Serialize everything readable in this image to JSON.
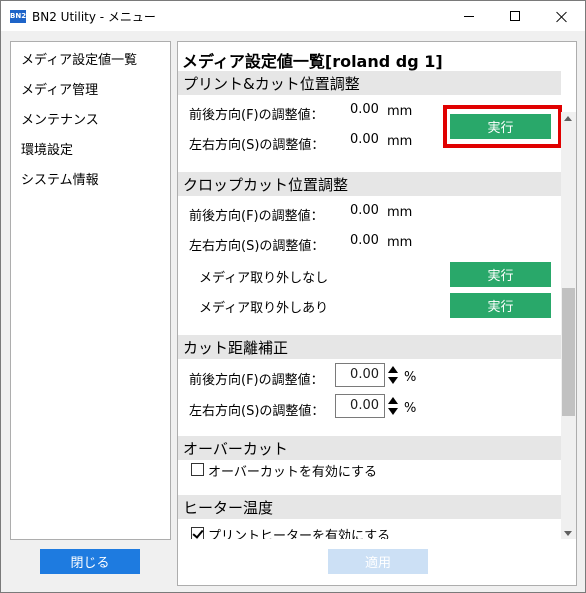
{
  "window": {
    "title": "BN2 Utility - メニュー",
    "app_icon_label": "BN2"
  },
  "sidebar": {
    "items": [
      {
        "label": "メディア設定値一覧"
      },
      {
        "label": "メディア管理"
      },
      {
        "label": "メンテナンス"
      },
      {
        "label": "環境設定"
      },
      {
        "label": "システム情報"
      }
    ]
  },
  "main": {
    "title": "メディア設定値一覧[roland dg 1]",
    "print_cut": {
      "header": "プリント&カット位置調整",
      "front_back_label": "前後方向(F)の調整値：",
      "front_back_value": "0.00",
      "left_right_label": "左右方向(S)の調整値：",
      "left_right_value": "0.00",
      "unit": "mm",
      "execute_label": "実行"
    },
    "crop_cut": {
      "header": "クロップカット位置調整",
      "front_back_label": "前後方向(F)の調整値：",
      "front_back_value": "0.00",
      "left_right_label": "左右方向(S)の調整値：",
      "left_right_value": "0.00",
      "unit": "mm",
      "no_removal_label": "メディア取り外しなし",
      "with_removal_label": "メディア取り外しあり",
      "execute_label": "実行"
    },
    "cut_distance": {
      "header": "カット距離補正",
      "front_back_label": "前後方向(F)の調整値：",
      "front_back_value": "0.00",
      "left_right_label": "左右方向(S)の調整値：",
      "left_right_value": "0.00",
      "unit": "%"
    },
    "overcut": {
      "header": "オーバーカット",
      "checkbox_label": "オーバーカットを有効にする",
      "checked": false
    },
    "heater": {
      "header": "ヒーター温度",
      "checkbox_label": "プリントヒーターを有効にする",
      "checked": true
    }
  },
  "footer": {
    "close_label": "閉じる",
    "apply_label": "適用"
  },
  "colors": {
    "accent_green": "#29a86a",
    "accent_blue": "#1e7be0",
    "highlight_red": "#e00000",
    "section_header_bg": "#e6e6e6"
  }
}
